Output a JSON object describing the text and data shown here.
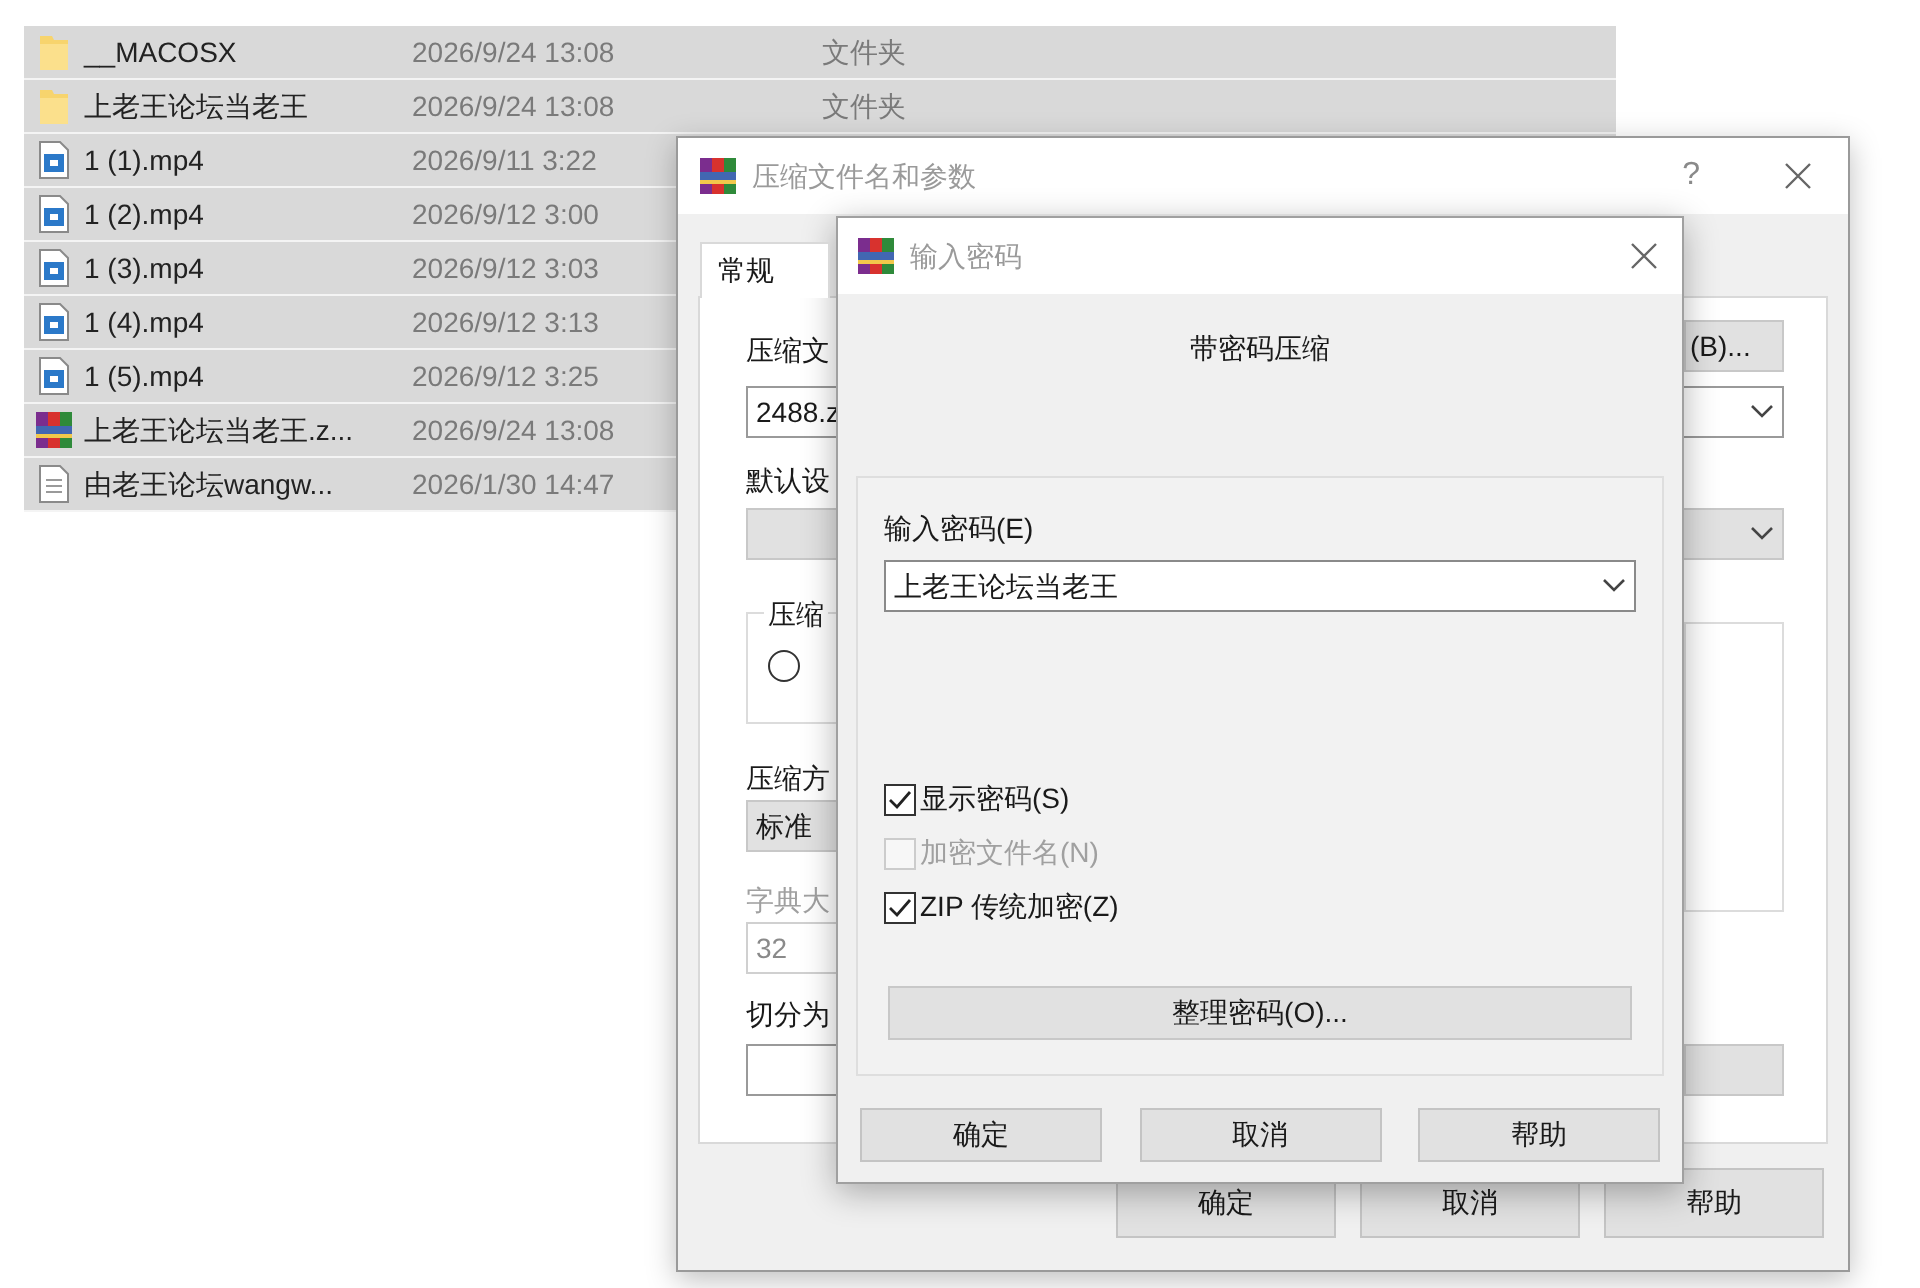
{
  "file_list": {
    "rows": [
      {
        "kind": "folder",
        "name": "__MACOSX",
        "date": "2026/9/24 13:08",
        "type": "文件夹",
        "selected": true
      },
      {
        "kind": "folder",
        "name": "上老王论坛当老王",
        "date": "2026/9/24 13:08",
        "type": "文件夹",
        "selected": true
      },
      {
        "kind": "video",
        "name": "1 (1).mp4",
        "date": "2026/9/11 3:22",
        "selected": true
      },
      {
        "kind": "video",
        "name": "1 (2).mp4",
        "date": "2026/9/12 3:00",
        "selected": true
      },
      {
        "kind": "video",
        "name": "1 (3).mp4",
        "date": "2026/9/12 3:03",
        "selected": true
      },
      {
        "kind": "video",
        "name": "1 (4).mp4",
        "date": "2026/9/12 3:13",
        "selected": true
      },
      {
        "kind": "video",
        "name": "1 (5).mp4",
        "date": "2026/9/12 3:25",
        "selected": true
      },
      {
        "kind": "archive",
        "name": "上老王论坛当老王.z...",
        "date": "2026/9/24 13:08",
        "selected": true
      },
      {
        "kind": "text",
        "name": "由老王论坛wangw...",
        "date": "2026/1/30 14:47",
        "selected": true
      }
    ]
  },
  "archive_dialog": {
    "title": "压缩文件名和参数",
    "help": "?",
    "tabs": [
      {
        "label": "常规",
        "selected": true
      }
    ],
    "archive_name_label": "压缩文",
    "browse_button": "(B)...",
    "archive_name_value": "2488.z",
    "profile_label": "默认设",
    "format_group_label": "压缩",
    "format_radio_checked": false,
    "method_label": "压缩方",
    "method_value": "标准",
    "dictionary_label": "字典大",
    "dictionary_value": "32",
    "dictionary_disabled": true,
    "split_label": "切分为",
    "buttons": [
      "确定",
      "取消",
      "帮助"
    ]
  },
  "password_dialog": {
    "title": "输入密码",
    "heading": "带密码压缩",
    "password_label": "输入密码(E)",
    "password_value": "上老王论坛当老王",
    "options": [
      {
        "label": "显示密码(S)",
        "checked": true,
        "disabled": false
      },
      {
        "label": "加密文件名(N)",
        "checked": false,
        "disabled": true
      },
      {
        "label": "ZIP 传统加密(Z)",
        "checked": true,
        "disabled": false
      }
    ],
    "organize_button": "整理密码(O)...",
    "buttons": [
      "确定",
      "取消",
      "帮助"
    ]
  }
}
